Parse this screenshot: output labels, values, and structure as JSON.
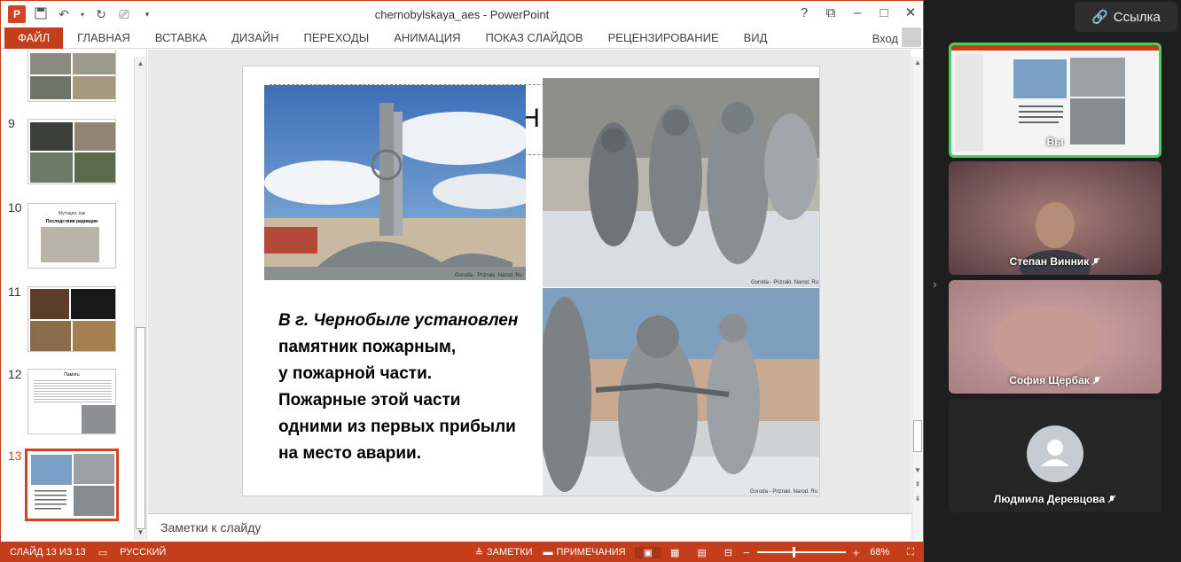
{
  "window": {
    "title": "chernobylskaya_aes - PowerPoint",
    "help": "?",
    "signin": "Вход"
  },
  "ribbon": {
    "tabs": [
      "ФАЙЛ",
      "ГЛАВНАЯ",
      "ВСТАВКА",
      "ДИЗАЙН",
      "ПЕРЕХОДЫ",
      "АНИМАЦИЯ",
      "ПОКАЗ СЛАЙДОВ",
      "РЕЦЕНЗИРОВАНИЕ",
      "ВИД"
    ]
  },
  "thumbnails": [
    {
      "num": "9"
    },
    {
      "num": "10",
      "caption": "Мутация, как",
      "title": "Последствия радиации"
    },
    {
      "num": "11"
    },
    {
      "num": "12",
      "title": "Память"
    },
    {
      "num": "13"
    }
  ],
  "slide": {
    "title_fragment": "ОН",
    "caption": "Goroda - Prizraki. Narod. Ru",
    "text_lines": [
      "В г. Чернобыле установлен",
      "памятник пожарным,",
      "у пожарной части.",
      "Пожарные этой части",
      "одними из первых прибыли",
      "на место аварии."
    ]
  },
  "notes": {
    "placeholder": "Заметки к слайду"
  },
  "status": {
    "slide_counter": "СЛАЙД 13 ИЗ 13",
    "language": "РУССКИЙ",
    "notes_btn": "ЗАМЕТКИ",
    "comments_btn": "ПРИМЕЧАНИЯ",
    "zoom_minus": "−",
    "zoom_plus": "+",
    "zoom": "68%",
    "zoom_level": 0.4
  },
  "meeting": {
    "link_label": "Ссылка",
    "participants": [
      {
        "name": "Вы"
      },
      {
        "name": "Степан Винник"
      },
      {
        "name": "София Щербак"
      },
      {
        "name": "Людмила Деревцова"
      }
    ]
  },
  "colors": {
    "accent": "#c43e1c",
    "self_border": "#43d25c"
  }
}
